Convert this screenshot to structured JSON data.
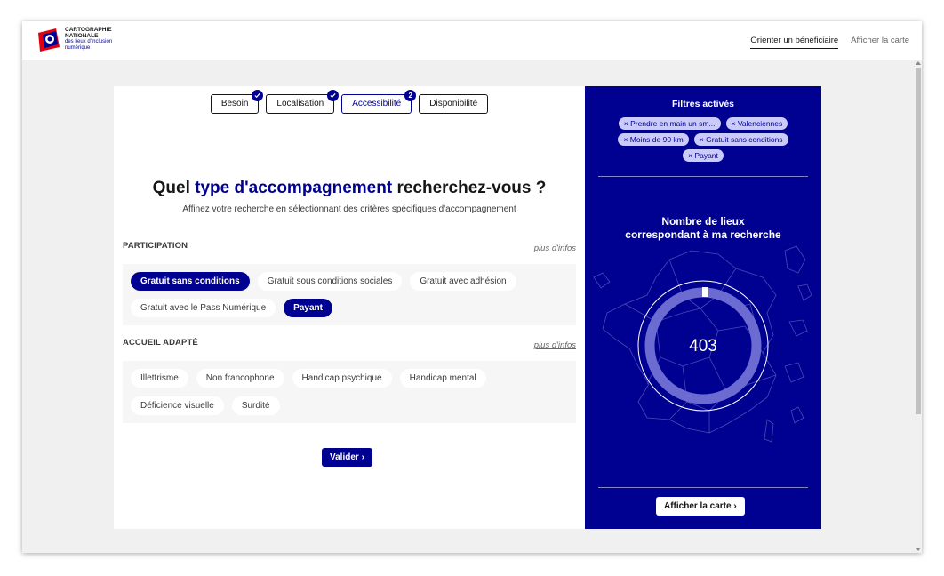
{
  "header": {
    "logo_line1": "CARTOGRAPHIE",
    "logo_line2": "NATIONALE",
    "logo_line3": "des lieux d'inclusion",
    "logo_line4": "numérique",
    "nav": [
      "Orienter un bénéficiaire",
      "Afficher la carte"
    ]
  },
  "stepper": [
    {
      "label": "Besoin",
      "badge": "check"
    },
    {
      "label": "Localisation",
      "badge": "check"
    },
    {
      "label": "Accessibilité",
      "badge": "2"
    },
    {
      "label": "Disponibilité",
      "badge": ""
    }
  ],
  "question": {
    "part1": "Quel ",
    "highlight": "type d'accompagnement",
    "part2": " recherchez-vous ?",
    "subtitle": "Affinez votre recherche en sélectionnant des critères spécifiques d'accompagnement"
  },
  "sections": [
    {
      "label": "PARTICIPATION",
      "link": "plus d'infos",
      "chips": [
        {
          "label": "Gratuit sans conditions",
          "selected": true
        },
        {
          "label": "Gratuit sous conditions sociales",
          "selected": false
        },
        {
          "label": "Gratuit avec adhésion",
          "selected": false
        },
        {
          "label": "Gratuit avec le Pass Numérique",
          "selected": false
        },
        {
          "label": "Payant",
          "selected": true
        }
      ]
    },
    {
      "label": "ACCUEIL ADAPTÉ",
      "link": "plus d'infos",
      "chips": [
        {
          "label": "Illettrisme",
          "selected": false
        },
        {
          "label": "Non francophone",
          "selected": false
        },
        {
          "label": "Handicap psychique",
          "selected": false
        },
        {
          "label": "Handicap mental",
          "selected": false
        },
        {
          "label": "Déficience visuelle",
          "selected": false
        },
        {
          "label": "Surdité",
          "selected": false
        }
      ]
    }
  ],
  "validate_label": "Valider",
  "panel": {
    "title": "Filtres activés",
    "tags": [
      "× Prendre en main un sm...",
      "× Valenciennes",
      "× Moins de 90 km",
      "× Gratuit sans conditions",
      "× Payant"
    ],
    "count_title_line1": "Nombre de lieux",
    "count_title_line2": "correspondant à ma recherche",
    "count": "403",
    "button_label": "Afficher la carte"
  },
  "colors": {
    "primary": "#000091",
    "tag_bg": "#cacafb",
    "chip_bg": "#ffffff",
    "box_bg": "#f6f6f6"
  }
}
